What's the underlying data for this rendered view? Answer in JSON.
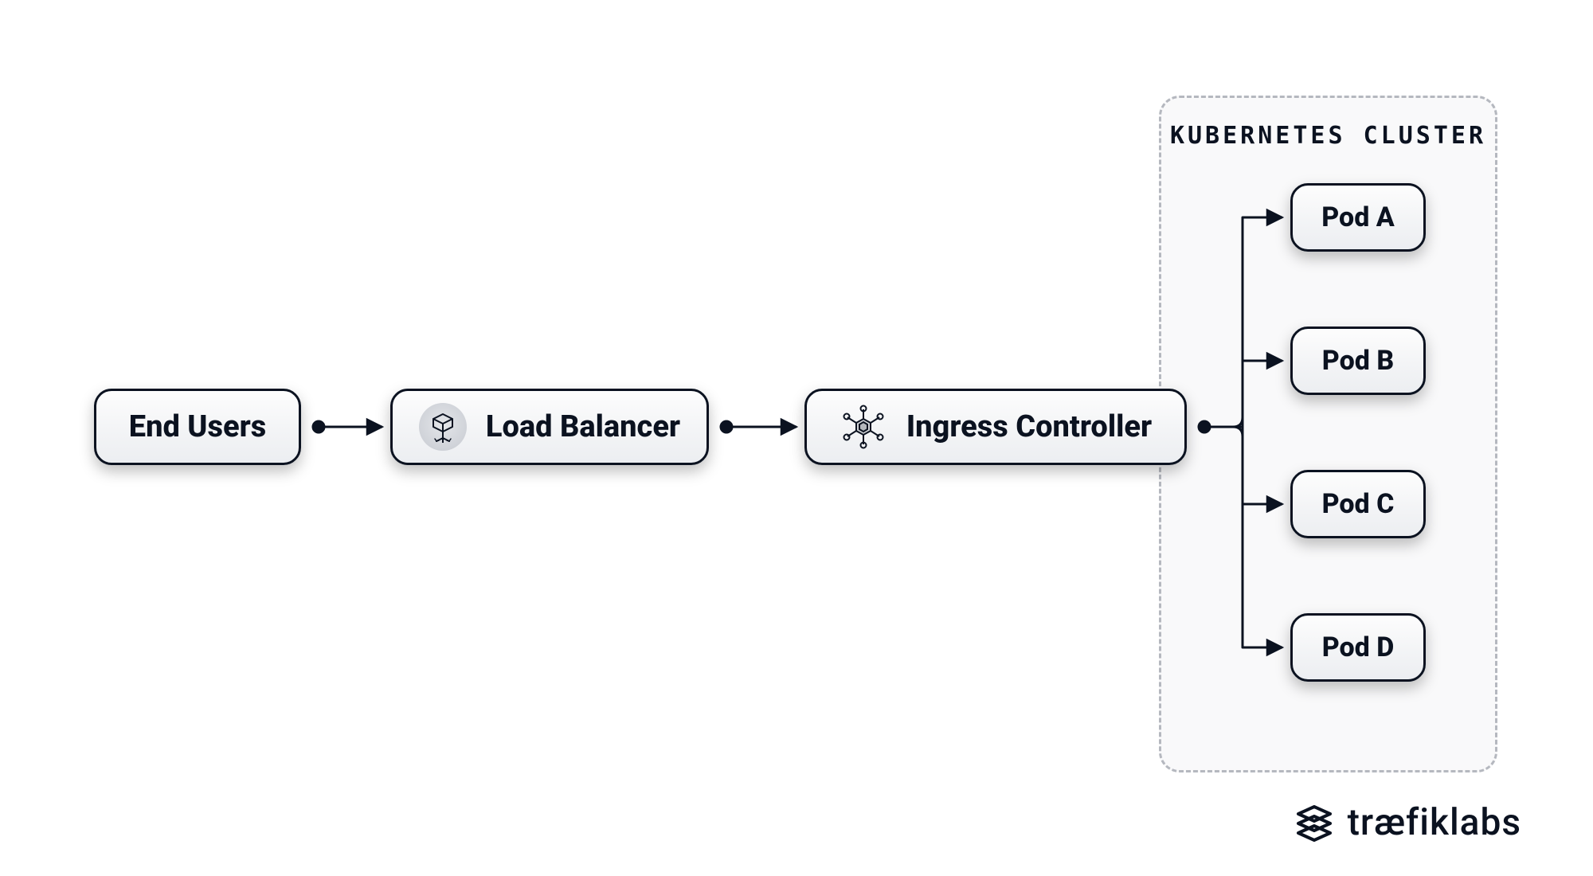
{
  "nodes": {
    "end_users": "End Users",
    "load_balancer": "Load Balancer",
    "ingress": "Ingress Controller"
  },
  "cluster": {
    "title": "KUBERNETES CLUSTER",
    "pods": [
      "Pod A",
      "Pod B",
      "Pod C",
      "Pod D"
    ]
  },
  "brand": {
    "name": "træfiklabs"
  },
  "icons": {
    "load_balancer": "load-balancer-icon",
    "ingress": "network-mesh-icon",
    "brand": "traefik-logo-icon"
  }
}
